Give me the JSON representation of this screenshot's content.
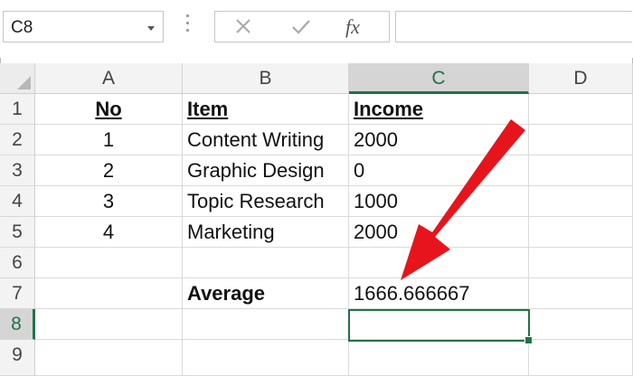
{
  "name_box": {
    "value": "C8"
  },
  "formula_buttons": {
    "cancel_icon": "close-icon",
    "enter_icon": "check-icon",
    "fx_label": "fx"
  },
  "formula_bar": {
    "value": ""
  },
  "columns": [
    "A",
    "B",
    "C",
    "D"
  ],
  "selected_column": "C",
  "rows": [
    "1",
    "2",
    "3",
    "4",
    "5",
    "6",
    "7",
    "8",
    "9"
  ],
  "selected_row": "8",
  "cells": {
    "A1": "No",
    "B1": "Item",
    "C1": "Income",
    "A2": "1",
    "B2": "Content Writing",
    "C2": "2000",
    "A3": "2",
    "B3": "Graphic Design",
    "C3": "0",
    "A4": "3",
    "B4": "Topic Research",
    "C4": "1000",
    "A5": "4",
    "B5": "Marketing",
    "C5": "2000",
    "B7": "Average",
    "C7": "1666.666667"
  },
  "annotation": {
    "arrow_color": "#e8141c"
  },
  "colors": {
    "accent": "#217346"
  }
}
